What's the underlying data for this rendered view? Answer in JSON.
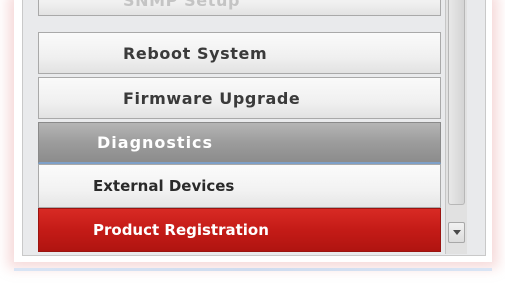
{
  "menu": {
    "items": [
      {
        "label": "SNMP Setup",
        "kind": "sub",
        "state": "cut-off"
      },
      {
        "label": "Reboot System",
        "kind": "sub"
      },
      {
        "label": "Firmware Upgrade",
        "kind": "sub"
      },
      {
        "label": "Diagnostics",
        "kind": "category"
      },
      {
        "label": "External Devices",
        "kind": "category"
      },
      {
        "label": "Product Registration",
        "kind": "category",
        "state": "highlighted"
      }
    ]
  },
  "scrollbar": {
    "down_arrow_icon": "chevron-down-icon"
  },
  "colors": {
    "highlight_red": "#c41b17",
    "category_gray": "#9c9c9c",
    "panel_bg": "#e9eaec",
    "glow": "#e69696"
  }
}
